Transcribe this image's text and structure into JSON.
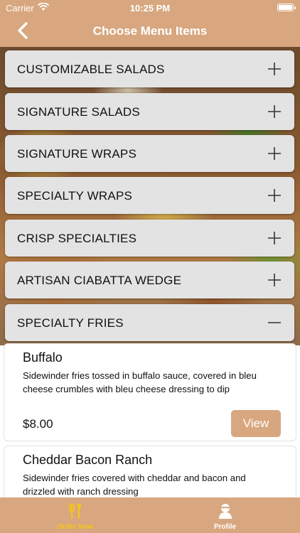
{
  "status": {
    "carrier": "Carrier",
    "time": "10:25 PM"
  },
  "header": {
    "title": "Choose Menu Items"
  },
  "categories": [
    {
      "label": "CUSTOMIZABLE SALADS",
      "expanded": false
    },
    {
      "label": "SIGNATURE SALADS",
      "expanded": false
    },
    {
      "label": "SIGNATURE WRAPS",
      "expanded": false
    },
    {
      "label": "SPECIALTY WRAPS",
      "expanded": false
    },
    {
      "label": "CRISP SPECIALTIES",
      "expanded": false
    },
    {
      "label": "ARTISAN CIABATTA WEDGE",
      "expanded": false
    },
    {
      "label": "SPECIALTY FRIES",
      "expanded": true
    }
  ],
  "items": [
    {
      "name": "Buffalo",
      "description": "Sidewinder fries tossed in buffalo sauce, covered in bleu cheese crumbles with bleu cheese dressing to dip",
      "price": "$8.00",
      "action": "View"
    },
    {
      "name": "Cheddar Bacon Ranch",
      "description": "Sidewinder fries covered with cheddar and bacon and drizzled with ranch dressing"
    }
  ],
  "tabbar": {
    "tabs": [
      {
        "label": "Order Now",
        "icon": "dining-icon",
        "active": true
      },
      {
        "label": "Profile",
        "icon": "person-icon",
        "active": false
      }
    ]
  },
  "colors": {
    "brand": "#d8a77f",
    "active_tab": "#f5c518",
    "inactive_tab": "#ffffff"
  }
}
